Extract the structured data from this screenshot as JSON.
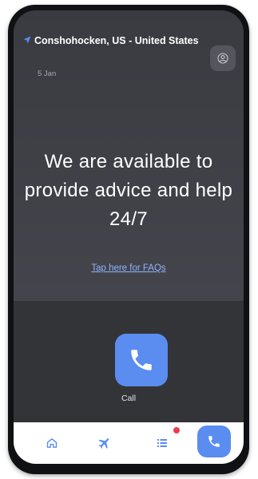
{
  "header": {
    "location": "Conshohocken, US - United States",
    "date": "5 Jan"
  },
  "main": {
    "headline": "We are available to provide advice and help 24/7",
    "faq_link": "Tap here for FAQs"
  },
  "call": {
    "label": "Call"
  },
  "tabbar": {
    "items": [
      "home-icon",
      "flight-icon",
      "list-icon",
      "phone-icon"
    ],
    "active": "phone-icon",
    "has_notification": true
  },
  "colors": {
    "accent": "#5b8df0",
    "background": "#3e3f45",
    "notification": "#ef3b4a",
    "link": "#8fb3ff"
  }
}
